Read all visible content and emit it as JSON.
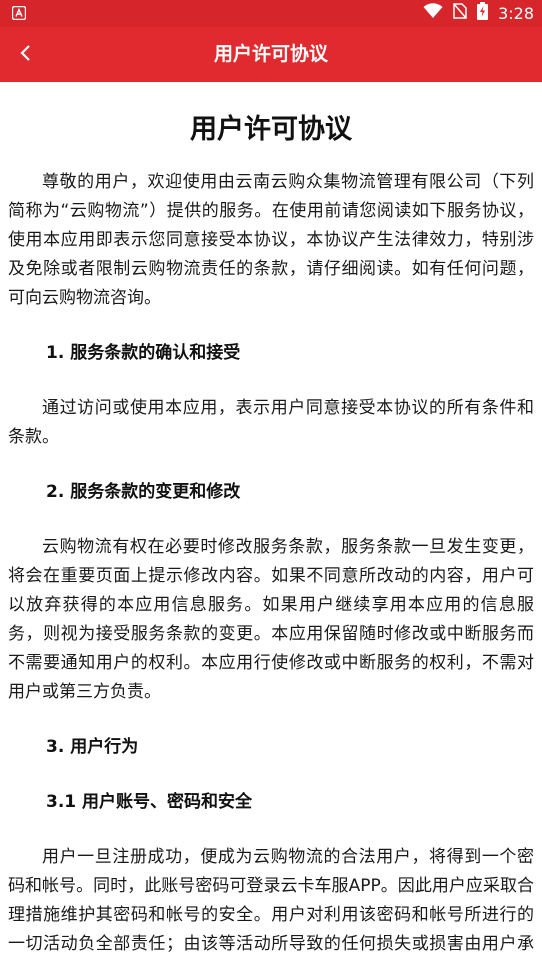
{
  "statusbar": {
    "time": "3:28",
    "icons": [
      "app-notification-icon",
      "wifi-icon",
      "no-sim-icon",
      "battery-charging-icon"
    ]
  },
  "appbar": {
    "title": "用户许可协议",
    "back_icon": "chevron-left-icon"
  },
  "document": {
    "title": "用户许可协议",
    "intro": "尊敬的用户，欢迎使用由云南云购众集物流管理有限公司（下列简称为“云购物流”）提供的服务。在使用前请您阅读如下服务协议，使用本应用即表示您同意接受本协议，本协议产生法律效力，特别涉及免除或者限制云购物流责任的条款，请仔细阅读。如有任何问题，可向云购物流咨询。",
    "sections": [
      {
        "heading": "1. 服务条款的确认和接受",
        "text": "通过访问或使用本应用，表示用户同意接受本协议的所有条件和条款。"
      },
      {
        "heading": "2. 服务条款的变更和修改",
        "text": "云购物流有权在必要时修改服务条款，服务条款一旦发生变更，将会在重要页面上提示修改内容。如果不同意所改动的内容，用户可以放弃获得的本应用信息服务。如果用户继续享用本应用的信息服务，则视为接受服务条款的变更。本应用保留随时修改或中断服务而不需要通知用户的权利。本应用行使修改或中断服务的权利，不需对用户或第三方负责。"
      },
      {
        "heading": "3. 用户行为",
        "text": ""
      },
      {
        "heading": "3.1 用户账号、密码和安全",
        "text": "用户一旦注册成功，便成为云购物流的合法用户，将得到一个密码和帐号。同时，此账号密码可登录云卡车服APP。因此用户应采取合理措施维护其密码和帐号的安全。用户对利用该密码和帐号所进行的一切活动负全部责任；由该等活动所导致的任何损失或损害由用户承担，云购物流不承担任何责任。"
      }
    ]
  }
}
